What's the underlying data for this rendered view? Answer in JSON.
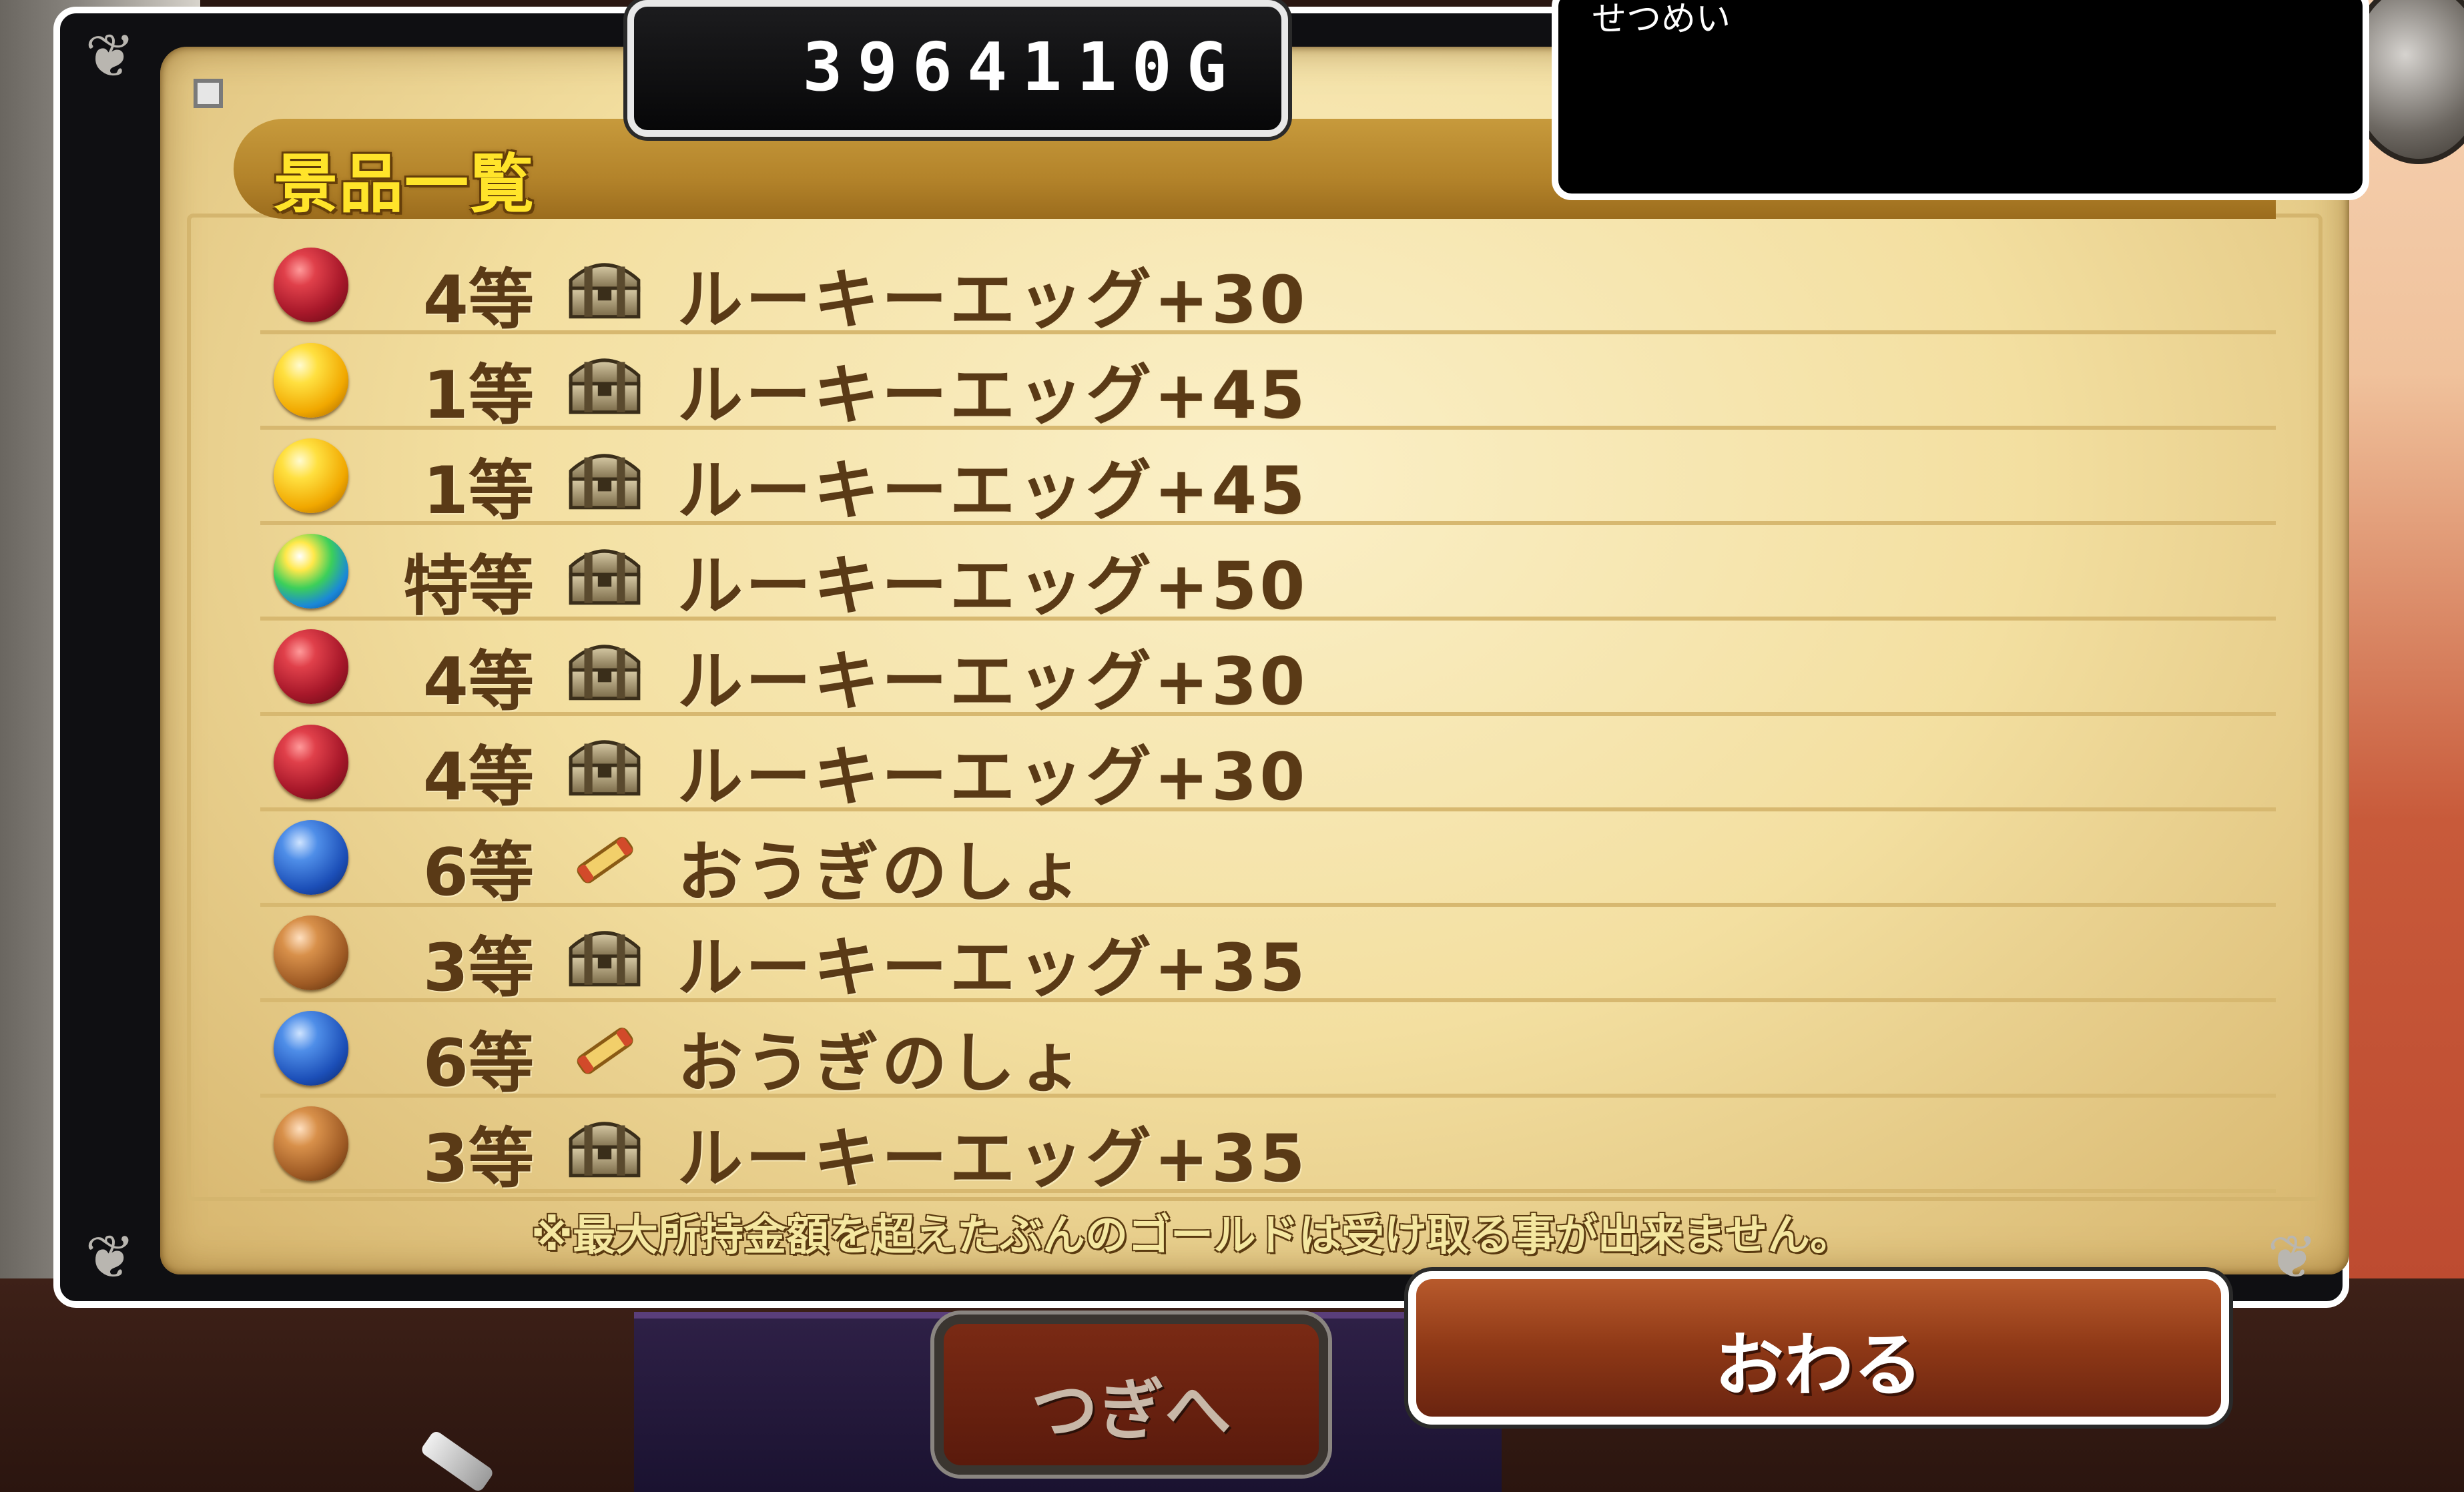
{
  "header": {
    "gold_amount": "3964110G",
    "title": "景品一覧",
    "description_label": "せつめい"
  },
  "prizes": [
    {
      "rank": "4等",
      "orb": "red",
      "icon": "treasure-chest-icon",
      "name": "ルーキーエッグ+30"
    },
    {
      "rank": "1等",
      "orb": "gold",
      "icon": "treasure-chest-icon",
      "name": "ルーキーエッグ+45"
    },
    {
      "rank": "1等",
      "orb": "gold",
      "icon": "treasure-chest-icon",
      "name": "ルーキーエッグ+45"
    },
    {
      "rank": "特等",
      "orb": "rainbow",
      "icon": "treasure-chest-icon",
      "name": "ルーキーエッグ+50"
    },
    {
      "rank": "4等",
      "orb": "red",
      "icon": "treasure-chest-icon",
      "name": "ルーキーエッグ+30"
    },
    {
      "rank": "4等",
      "orb": "red",
      "icon": "treasure-chest-icon",
      "name": "ルーキーエッグ+30"
    },
    {
      "rank": "6等",
      "orb": "blue",
      "icon": "scroll-icon",
      "name": "おうぎのしょ"
    },
    {
      "rank": "3等",
      "orb": "bronze",
      "icon": "treasure-chest-icon",
      "name": "ルーキーエッグ+35"
    },
    {
      "rank": "6等",
      "orb": "blue",
      "icon": "scroll-icon",
      "name": "おうぎのしょ"
    },
    {
      "rank": "3等",
      "orb": "bronze",
      "icon": "treasure-chest-icon",
      "name": "ルーキーエッグ+35"
    }
  ],
  "notice": "※最大所持金額を超えたぶんのゴールドは受け取る事が出来ません。",
  "buttons": {
    "next_label": "つぎへ",
    "end_label": "おわる"
  },
  "colors": {
    "title_text": "#ffe42a",
    "list_text": "#5a3a16",
    "parchment": "#f3dfa0",
    "end_button": "#8e3816"
  }
}
